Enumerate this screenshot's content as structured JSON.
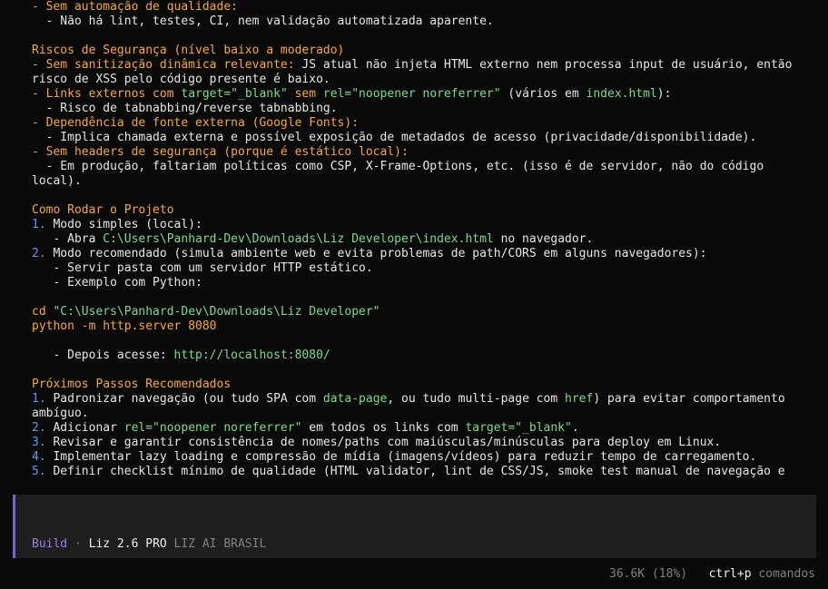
{
  "colors": {
    "background": "#0a0a0a",
    "heading": "#f5a742",
    "list_number": "#5c9cf5",
    "code": "#7fd88f",
    "input_bg": "#1e1e1e",
    "input_border": "#7b5fd6"
  },
  "content": {
    "l1": "- Sem automação de qualidade:",
    "l2": "  - Não há lint, testes, CI, nem validação automatizada aparente.",
    "h_riscos": "Riscos de Segurança (nível baixo a moderado)",
    "r1_label": "- Sem sanitização dinâmica relevante:",
    "r1_text": " JS atual não injeta HTML externo nem processa input de usuário, então",
    "r1_cont": "risco de XSS pelo código presente é baixo.",
    "r2_a": "- Links externos com ",
    "r2_code1": "target=\"_blank\"",
    "r2_b": " sem ",
    "r2_code2": "rel=\"noopener noreferrer\"",
    "r2_c": " (vários em ",
    "r2_code3": "index.html",
    "r2_d": "):",
    "r2_sub": "  - Risco de tabnabbing/reverse tabnabbing.",
    "r3": "- Dependência de fonte externa (Google Fonts):",
    "r3_sub": "  - Implica chamada externa e possível exposição de metadados de acesso (privacidade/disponibilidade).",
    "r4": "- Sem headers de segurança (porque é estático local):",
    "r4_sub": "  - Em produção, faltariam políticas como CSP, X-Frame-Options, etc. (isso é de servidor, não do código",
    "r4_cont": "local).",
    "h_rodar": "Como Rodar o Projeto",
    "c1_num": "1.",
    "c1": " Modo simples (local):",
    "c1_sub_a": "   - Abra ",
    "c1_sub_code": "C:\\Users\\Panhard-Dev\\Downloads\\Liz Developer\\index.html",
    "c1_sub_b": " no navegador.",
    "c2_num": "2.",
    "c2": " Modo recomendado (simula ambiente web e evita problemas de path/CORS em alguns navegadores):",
    "c2_sub1": "   - Servir pasta com um servidor HTTP estático.",
    "c2_sub2": "   - Exemplo com Python:",
    "cmd1_a": "cd ",
    "cmd1_b": "\"C:\\Users\\Panhard-Dev\\Downloads\\Liz Developer\"",
    "cmd2_a": "python -m ",
    "cmd2_b": "http.server 8080",
    "after_a": "   - Depois acesse: ",
    "after_b": "http://localhost:8080/",
    "h_proximos": "Próximos Passos Recomendados",
    "p1_num": "1.",
    "p1_a": " Padronizar navegação (ou tudo SPA com ",
    "p1_code1": "data-page",
    "p1_b": ", ou tudo multi-page com ",
    "p1_code2": "href",
    "p1_c": ") para evitar comportamento",
    "p1_cont": "ambíguo.",
    "p2_num": "2.",
    "p2_a": " Adicionar ",
    "p2_code1": "rel=\"noopener noreferrer\"",
    "p2_b": " em todos os links com ",
    "p2_code2": "target=\"_blank\"",
    "p2_c": ".",
    "p3_num": "3.",
    "p3": " Revisar e garantir consistência de nomes/paths com maiúsculas/minúsculas para deploy em Linux.",
    "p4_num": "4.",
    "p4": " Implementar lazy loading e compressão de mídia (imagens/vídeos) para reduzir tempo de carregamento.",
    "p5_num": "5.",
    "p5": " Definir checklist mínimo de qualidade (HTML validator, lint de CSS/JS, smoke test manual de navegação e"
  },
  "input": {
    "mode": "Build",
    "sep": " · ",
    "model": "Liz 2.6 PRO",
    "provider": " LIZ AI BRASIL"
  },
  "footer": {
    "tokens": "36.6K (18%)",
    "shortcut": "ctrl+p",
    "shortcut_label": " comandos"
  }
}
